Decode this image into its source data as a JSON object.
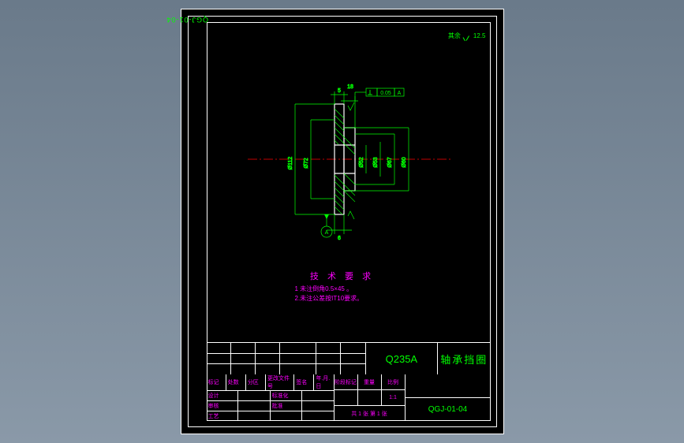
{
  "drawing_number": "QGJ-01-04",
  "drawing_number_top": "QGJ-01-04",
  "top_right_label": "其余",
  "top_right_value": "12.5",
  "gdt": {
    "tol": "0.05",
    "datum": "A"
  },
  "dimensions": {
    "d1": "Ø112",
    "d2": "Ø72",
    "d3": "Ø52",
    "d4": "Ø53",
    "d5": "Ø67",
    "d6": "Ø60",
    "w1": "5",
    "w2": "6",
    "w3": "18"
  },
  "datum_label": "A",
  "notes": {
    "title": "技 术 要 求",
    "line1": "1 未注倒角0.5×45 。",
    "line2": "2.未注公差按IT10要求。"
  },
  "titleblock": {
    "material": "Q235A",
    "part_name": "轴承挡圈",
    "rev_heads": [
      "标记",
      "处数",
      "分区",
      "更改文件号",
      "签名",
      "年.月.日"
    ],
    "left_rows": [
      [
        "设计",
        "",
        "标准化",
        ""
      ],
      [
        "绘图",
        "",
        "",
        ""
      ],
      [
        "审核",
        "",
        "批准",
        ""
      ],
      [
        "工艺",
        "",
        "",
        ""
      ]
    ],
    "mid_labels": [
      "阶段标记",
      "重量",
      "比例"
    ],
    "scale": "1:1",
    "sheet": "共 1 张 第 1 张"
  },
  "chart_data": {
    "type": "engineering-drawing-section",
    "part": "bearing retainer ring",
    "diameters_mm": [
      112,
      72,
      67,
      60,
      53,
      52
    ],
    "widths_mm": {
      "flange": 5,
      "step": 6,
      "overall": 18
    },
    "tolerances": {
      "perpendicularity": 0.05,
      "default_IT": "IT10",
      "default_chamfer": "0.5x45"
    },
    "material": "Q235A",
    "surface_roughness_default": 12.5
  }
}
